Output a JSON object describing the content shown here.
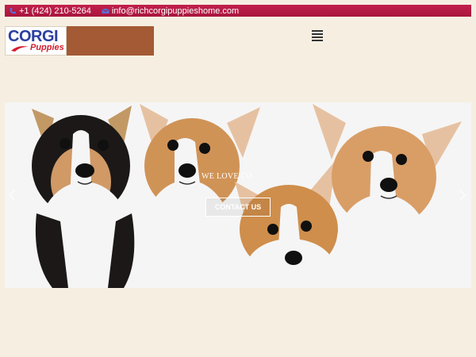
{
  "topbar": {
    "phone": "+1 (424) 210-5264",
    "email": "info@richcorgipuppieshome.com",
    "phone_icon": "phone-icon",
    "email_icon": "envelope-icon"
  },
  "logo": {
    "line1": "CORGI",
    "line2": "Puppies",
    "colors": {
      "line1": "#2a3fa0",
      "line2": "#d21d2f"
    }
  },
  "header": {
    "menu_icon": "hamburger-menu-icon"
  },
  "hero": {
    "tagline": "WE LOVE CO",
    "cta_label": "CONTACT US",
    "prev_icon": "chevron-left-icon",
    "next_icon": "chevron-right-icon"
  },
  "colors": {
    "topbar": "#b81b45",
    "page_bg": "#f6efe1",
    "brown_block": "#a45a35"
  }
}
